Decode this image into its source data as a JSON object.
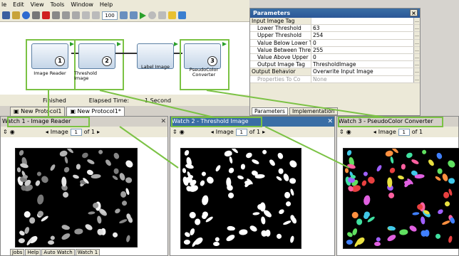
{
  "menubar": [
    "le",
    "Edit",
    "View",
    "Tools",
    "Window",
    "Help"
  ],
  "toolbar": {
    "zoom": "100"
  },
  "canvas": {
    "nodes": [
      {
        "label": "Image Reader",
        "num": "1"
      },
      {
        "label": "Threshold Image",
        "num": "2"
      },
      {
        "label": "Label Image",
        "num": ""
      },
      {
        "label": "PseudoColor Converter",
        "num": "3"
      }
    ]
  },
  "status": {
    "state": "Finished",
    "elapsed_label": "Elapsed Time:",
    "elapsed_value": "1 Second"
  },
  "protocol_tabs": [
    "New Protocol1",
    "New Protocol1*"
  ],
  "params": {
    "title": "Parameters",
    "close": "×",
    "rows": [
      {
        "name": "Input Image Tag",
        "value": "",
        "group": true
      },
      {
        "name": "Lower Threshold",
        "value": "63"
      },
      {
        "name": "Upper Threshold",
        "value": "254"
      },
      {
        "name": "Value Below Lower T",
        "value": "0"
      },
      {
        "name": "Value Between Thre",
        "value": "255"
      },
      {
        "name": "Value Above Upper",
        "value": "0"
      },
      {
        "name": "Output Image Tag",
        "value": "ThresholdImage"
      },
      {
        "name": "Output Behavior",
        "value": "Overwrite Input Image",
        "group": true
      },
      {
        "name": "Properties To Co",
        "value": "None",
        "disabled": true
      }
    ],
    "tabs": [
      "Parameters",
      "Implementation"
    ]
  },
  "watches": [
    {
      "title": "Watch 1 - Image Reader",
      "image_label": "Image",
      "page": "1",
      "of": "of 1"
    },
    {
      "title": "Watch 2 - Threshold Image",
      "image_label": "Image",
      "page": "1",
      "of": "of 1"
    },
    {
      "title": "Watch 3 - PseudoColor Converter",
      "image_label": "Image",
      "page": "1",
      "of": "of 1"
    }
  ],
  "bottom_tabs": [
    "Jobs",
    "Help",
    "Auto Watch",
    "Watch 1"
  ],
  "colors": {
    "callout": "#7bc244",
    "title_bar": "#3a6ea5"
  }
}
